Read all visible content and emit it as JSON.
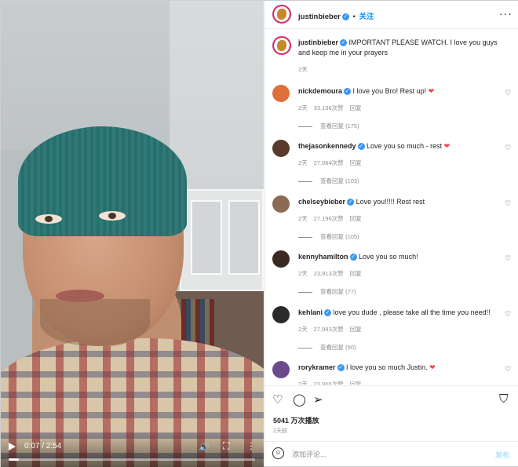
{
  "video": {
    "time": "0:07 / 2:54",
    "progress": 0.04
  },
  "post": {
    "author": "justinbieber",
    "follow_label": "关注",
    "separator": "•",
    "menu_icon": "more-horizontal-icon",
    "caption_author": "justinbieber",
    "caption_text": "IMPORTANT PLEASE WATCH. I love you guys and keep me in your prayers",
    "caption_age": "2天",
    "views": "5041 万次播放",
    "posted": "2天前"
  },
  "comments": [
    {
      "user": "nickdemoura",
      "text": "I love you Bro! Rest up!",
      "heart": "❤",
      "age": "2天",
      "likes": "33,136次赞",
      "reply": "回复",
      "view_replies": "查看回复 (175)",
      "avatar_color": "#e0703a"
    },
    {
      "user": "thejasonkennedy",
      "text": "Love you so much - rest",
      "heart": "❤",
      "age": "2天",
      "likes": "27,064次赞",
      "reply": "回复",
      "view_replies": "查看回复 (103)",
      "avatar_color": "#5a3a2e"
    },
    {
      "user": "chelseybieber",
      "text": "Love you!!!!! Rest rest",
      "heart": "",
      "age": "2天",
      "likes": "27,196次赞",
      "reply": "回复",
      "view_replies": "查看回复 (105)",
      "avatar_color": "#8c6b55"
    },
    {
      "user": "kennyhamilton",
      "text": "Love you so much!",
      "heart": "",
      "age": "2天",
      "likes": "23,913次赞",
      "reply": "回复",
      "view_replies": "查看回复 (77)",
      "avatar_color": "#3a2a22"
    },
    {
      "user": "kehlani",
      "text": "love you dude , please take all the time you need!!",
      "heart": "",
      "age": "2天",
      "likes": "27,993次赞",
      "reply": "回复",
      "view_replies": "查看回复 (50)",
      "avatar_color": "#2b2b2b"
    },
    {
      "user": "rorykramer",
      "text": "I love you so much Justin.",
      "heart": "❤",
      "age": "2天",
      "likes": "33,966次赞",
      "reply": "回复",
      "view_replies": "",
      "avatar_color": "#6b4a8a"
    }
  ],
  "composer": {
    "placeholder": "添加评论...",
    "post_label": "发布"
  },
  "icons": {
    "like": "heart-icon",
    "comment": "comment-icon",
    "share": "share-icon",
    "save": "bookmark-icon",
    "emoji": "emoji-icon"
  },
  "colors": {
    "link_blue": "#0095f6",
    "verified_blue": "#3897f0",
    "like_red": "#ed4956",
    "muted": "#8e8e8e"
  }
}
